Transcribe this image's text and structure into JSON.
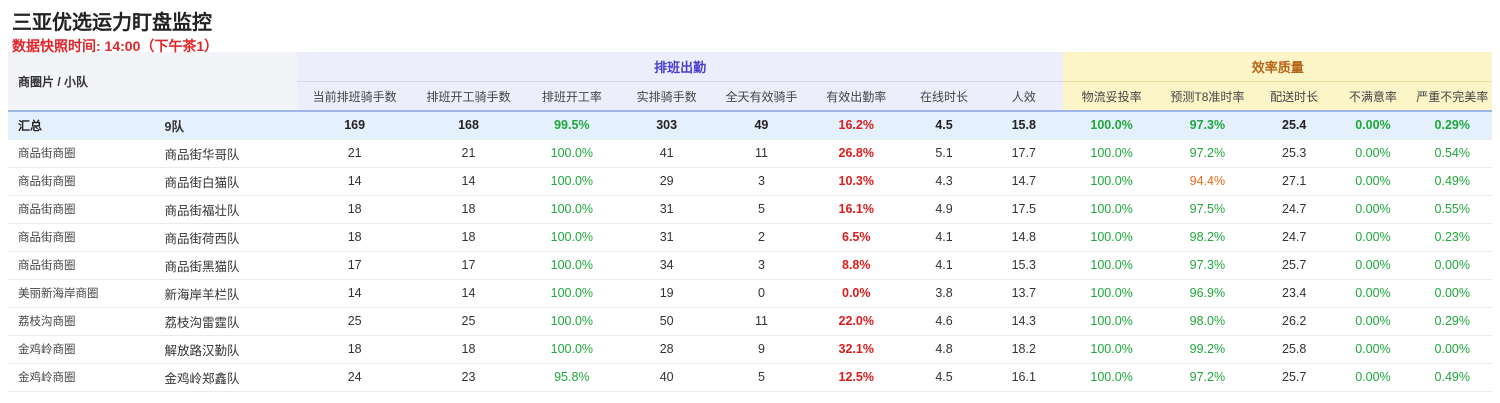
{
  "title": "三亚优选运力盯盘监控",
  "subtitle": "数据快照时间: 14:00（下午茶1）",
  "table": {
    "team_header": "商圈片 / 小队",
    "group_schedule": "排班出勤",
    "group_efficiency": "效率质量",
    "columns": [
      "当前排班骑手数",
      "排班开工骑手数",
      "排班开工率",
      "实排骑手数",
      "全天有效骑手",
      "有效出勤率",
      "在线时长",
      "人效",
      "物流妥投率",
      "预测T8准时率",
      "配送时长",
      "不满意率",
      "严重不完美率"
    ],
    "summary": {
      "area": "汇总",
      "team": "9队",
      "cells": [
        "169",
        "168",
        "99.5%",
        "303",
        "49",
        "16.2%",
        "4.5",
        "15.8",
        "100.0%",
        "97.3%",
        "25.4",
        "0.00%",
        "0.29%"
      ]
    },
    "rows": [
      {
        "area": "商品街商圈",
        "team": "商品街华哥队",
        "cells": [
          "21",
          "21",
          "100.0%",
          "41",
          "11",
          "26.8%",
          "5.1",
          "17.7",
          "100.0%",
          "97.2%",
          "25.3",
          "0.00%",
          "0.54%"
        ]
      },
      {
        "area": "商品街商圈",
        "team": "商品街白猫队",
        "cells": [
          "14",
          "14",
          "100.0%",
          "29",
          "3",
          "10.3%",
          "4.3",
          "14.7",
          "100.0%",
          "94.4%",
          "27.1",
          "0.00%",
          "0.49%"
        ]
      },
      {
        "area": "商品街商圈",
        "team": "商品街福壮队",
        "cells": [
          "18",
          "18",
          "100.0%",
          "31",
          "5",
          "16.1%",
          "4.9",
          "17.5",
          "100.0%",
          "97.5%",
          "24.7",
          "0.00%",
          "0.55%"
        ]
      },
      {
        "area": "商品街商圈",
        "team": "商品街荷西队",
        "cells": [
          "18",
          "18",
          "100.0%",
          "31",
          "2",
          "6.5%",
          "4.1",
          "14.8",
          "100.0%",
          "98.2%",
          "24.7",
          "0.00%",
          "0.23%"
        ]
      },
      {
        "area": "商品街商圈",
        "team": "商品街黑猫队",
        "cells": [
          "17",
          "17",
          "100.0%",
          "34",
          "3",
          "8.8%",
          "4.1",
          "15.3",
          "100.0%",
          "97.3%",
          "25.7",
          "0.00%",
          "0.00%"
        ]
      },
      {
        "area": "美丽新海岸商圈",
        "team": "新海岸羊栏队",
        "cells": [
          "14",
          "14",
          "100.0%",
          "19",
          "0",
          "0.0%",
          "3.8",
          "13.7",
          "100.0%",
          "96.9%",
          "23.4",
          "0.00%",
          "0.00%"
        ]
      },
      {
        "area": "荔枝沟商圈",
        "team": "荔枝沟雷霆队",
        "cells": [
          "25",
          "25",
          "100.0%",
          "50",
          "11",
          "22.0%",
          "4.6",
          "14.3",
          "100.0%",
          "98.0%",
          "26.2",
          "0.00%",
          "0.29%"
        ]
      },
      {
        "area": "金鸡岭商圈",
        "team": "解放路汉勤队",
        "cells": [
          "18",
          "18",
          "100.0%",
          "28",
          "9",
          "32.1%",
          "4.8",
          "18.2",
          "100.0%",
          "99.2%",
          "25.8",
          "0.00%",
          "0.00%"
        ]
      },
      {
        "area": "金鸡岭商圈",
        "team": "金鸡岭郑鑫队",
        "cells": [
          "24",
          "23",
          "95.8%",
          "40",
          "5",
          "12.5%",
          "4.5",
          "16.1",
          "100.0%",
          "97.2%",
          "25.7",
          "0.00%",
          "0.49%"
        ]
      }
    ],
    "colors": {
      "good": "#1fa83a",
      "bad": "#dd1c1c",
      "warn": "#ea6d1e",
      "summary_bg": "#e4f1fc",
      "schedule_bg": "#eceefb",
      "efficiency_bg": "#fcf5c8"
    }
  }
}
